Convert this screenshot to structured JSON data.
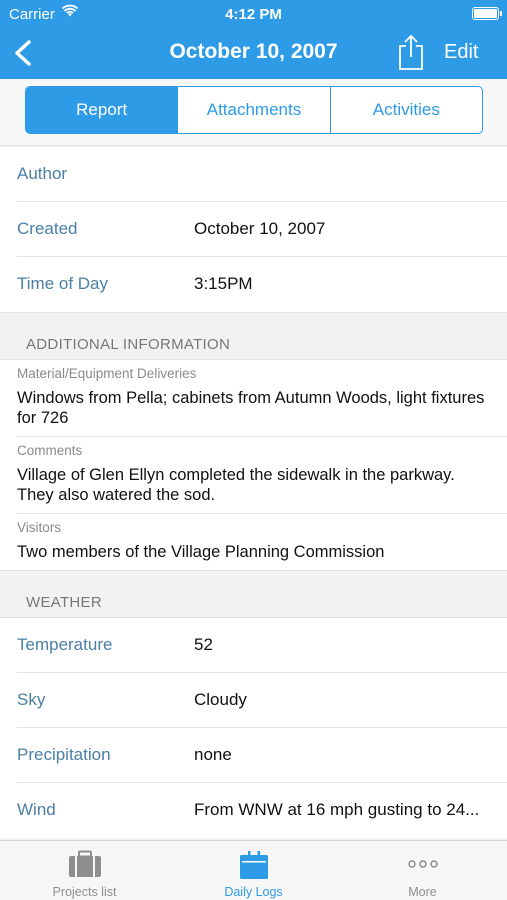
{
  "status_bar": {
    "carrier": "Carrier",
    "time": "4:12 PM"
  },
  "nav": {
    "title": "October 10, 2007",
    "edit_label": "Edit",
    "back_icon": "chevron-left-icon",
    "share_icon": "share-icon"
  },
  "segments": [
    {
      "label": "Report",
      "active": true
    },
    {
      "label": "Attachments",
      "active": false
    },
    {
      "label": "Activities",
      "active": false
    }
  ],
  "report": {
    "rows": [
      {
        "label": "Author",
        "value": ""
      },
      {
        "label": "Created",
        "value": "October 10, 2007"
      },
      {
        "label": "Time of Day",
        "value": "3:15PM"
      }
    ]
  },
  "additional": {
    "header": "ADDITIONAL INFORMATION",
    "notes": [
      {
        "label": "Material/Equipment Deliveries",
        "text": "Windows from Pella; cabinets from Autumn Woods, light fixtures for 726"
      },
      {
        "label": "Comments",
        "text": "Village of Glen Ellyn completed the sidewalk in the parkway. They also watered the sod."
      },
      {
        "label": "Visitors",
        "text": "Two members of the Village Planning Commission"
      }
    ]
  },
  "weather": {
    "header": "WEATHER",
    "rows": [
      {
        "label": "Temperature",
        "value": "52"
      },
      {
        "label": "Sky",
        "value": "Cloudy"
      },
      {
        "label": "Precipitation",
        "value": "none"
      },
      {
        "label": "Wind",
        "value": "From WNW at 16 mph  gusting to 24..."
      }
    ]
  },
  "tabbar": [
    {
      "label": "Projects list",
      "icon": "briefcase-icon",
      "active": false
    },
    {
      "label": "Daily Logs",
      "icon": "calendar-icon",
      "active": true
    },
    {
      "label": "More",
      "icon": "more-dots-icon",
      "active": false
    }
  ],
  "colors": {
    "accent": "#2e9be6",
    "label_blue": "#4a7fa5"
  }
}
